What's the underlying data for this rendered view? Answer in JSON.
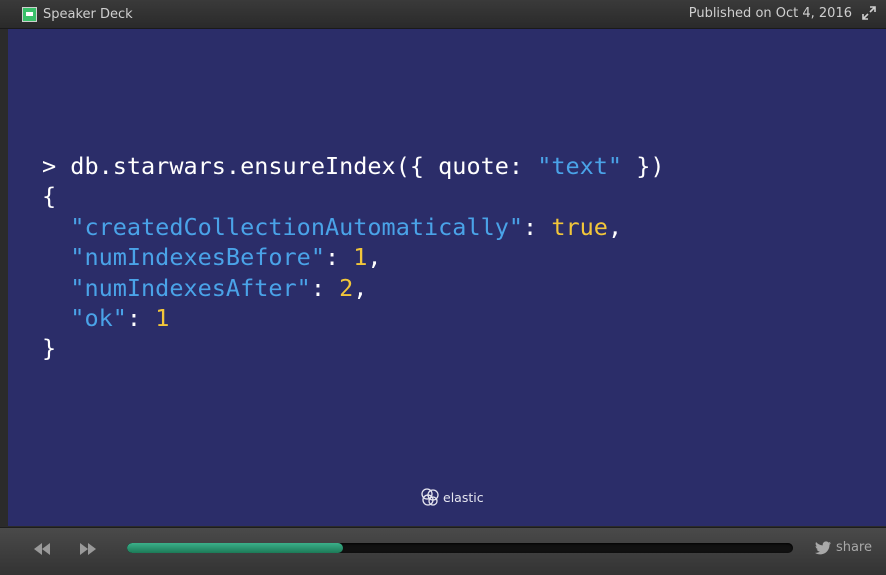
{
  "header": {
    "brand": "Speaker Deck",
    "published": "Published on Oct 4, 2016",
    "brand_icon": "speakerdeck-logo-icon",
    "expand_icon": "fullscreen-expand-icon"
  },
  "slide": {
    "line1_prompt": "> ",
    "line1_cmd": "db.starwars.ensureIndex({ quote: ",
    "line1_str": "\"text\"",
    "line1_end": " })",
    "open_brace": "{",
    "k1": "\"createdCollectionAutomatically\"",
    "v1": "true",
    "k2": "\"numIndexesBefore\"",
    "v2": "1",
    "k3": "\"numIndexesAfter\"",
    "v3": "2",
    "k4": "\"ok\"",
    "v4": "1",
    "close_brace": "}",
    "colon": ": ",
    "comma": ",",
    "indent": "  ",
    "footer_logo_text": "elastic",
    "footer_icon": "elastic-logo-icon"
  },
  "controls": {
    "prev_icon": "rewind-icon",
    "next_icon": "fast-forward-icon",
    "progress": 0.325,
    "share_label": "share",
    "share_icon": "twitter-bird-icon"
  },
  "colors": {
    "slide_bg": "#2b2d69",
    "string": "#4aa3e8",
    "number": "#f2c63a",
    "progress": "#2aa37a"
  }
}
